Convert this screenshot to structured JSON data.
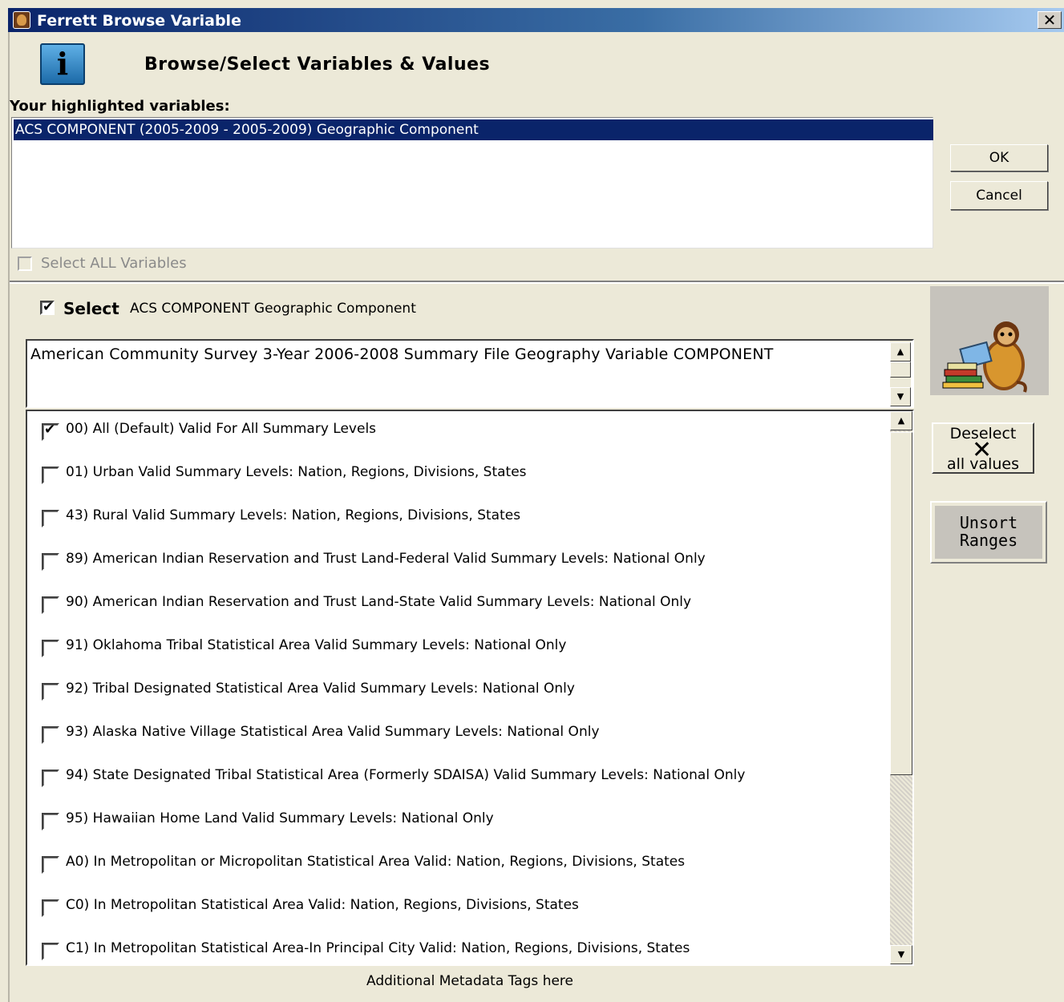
{
  "window": {
    "title": "Ferrett Browse Variable",
    "close_label": "✕"
  },
  "header": {
    "icon_glyph": "i",
    "heading": "Browse/Select Variables & Values"
  },
  "highlighted": {
    "label": "Your highlighted variables:",
    "items": [
      "ACS COMPONENT (2005-2009 - 2005-2009) Geographic Component"
    ],
    "select_all_label": "Select ALL Variables"
  },
  "buttons": {
    "ok": "OK",
    "cancel": "Cancel",
    "deselect_top": "Deselect",
    "deselect_bottom": "all values",
    "unsort_line1": "Unsort",
    "unsort_line2": "Ranges"
  },
  "selected_var": {
    "select_label": "Select",
    "name": "ACS  COMPONENT  Geographic Component",
    "checked": true,
    "description": "American Community Survey 3-Year 2006-2008 Summary File Geography Variable COMPONENT"
  },
  "values": [
    {
      "text": "00)  All (Default)  Valid For All Summary Levels",
      "checked": true
    },
    {
      "text": "01)  Urban Valid Summary Levels:  Nation, Regions, Divisions, States",
      "checked": false
    },
    {
      "text": "43)  Rural Valid Summary Levels:  Nation, Regions, Divisions, States",
      "checked": false
    },
    {
      "text": "89)  American Indian Reservation and Trust Land-Federal Valid Summary Levels:  National Only",
      "checked": false
    },
    {
      "text": "90)  American Indian Reservation and Trust Land-State Valid Summary Levels:  National Only",
      "checked": false
    },
    {
      "text": "91)  Oklahoma Tribal Statistical Area Valid Summary Levels:  National Only",
      "checked": false
    },
    {
      "text": "92)  Tribal Designated Statistical Area Valid Summary Levels:  National Only",
      "checked": false
    },
    {
      "text": "93)  Alaska Native Village Statistical Area Valid Summary Levels:  National Only",
      "checked": false
    },
    {
      "text": "94)  State Designated Tribal Statistical Area (Formerly SDAISA) Valid Summary Levels:  National Only",
      "checked": false
    },
    {
      "text": "95)  Hawaiian Home Land Valid Summary Levels:  National Only",
      "checked": false
    },
    {
      "text": "A0)  In Metropolitan or Micropolitan Statistical Area Valid:  Nation, Regions, Divisions, States",
      "checked": false
    },
    {
      "text": "C0)  In Metropolitan Statistical Area Valid:  Nation, Regions, Divisions, States",
      "checked": false
    },
    {
      "text": "C1)  In Metropolitan Statistical Area-In Principal City Valid:  Nation, Regions, Divisions, States",
      "checked": false
    }
  ],
  "footer": "Additional Metadata Tags here"
}
